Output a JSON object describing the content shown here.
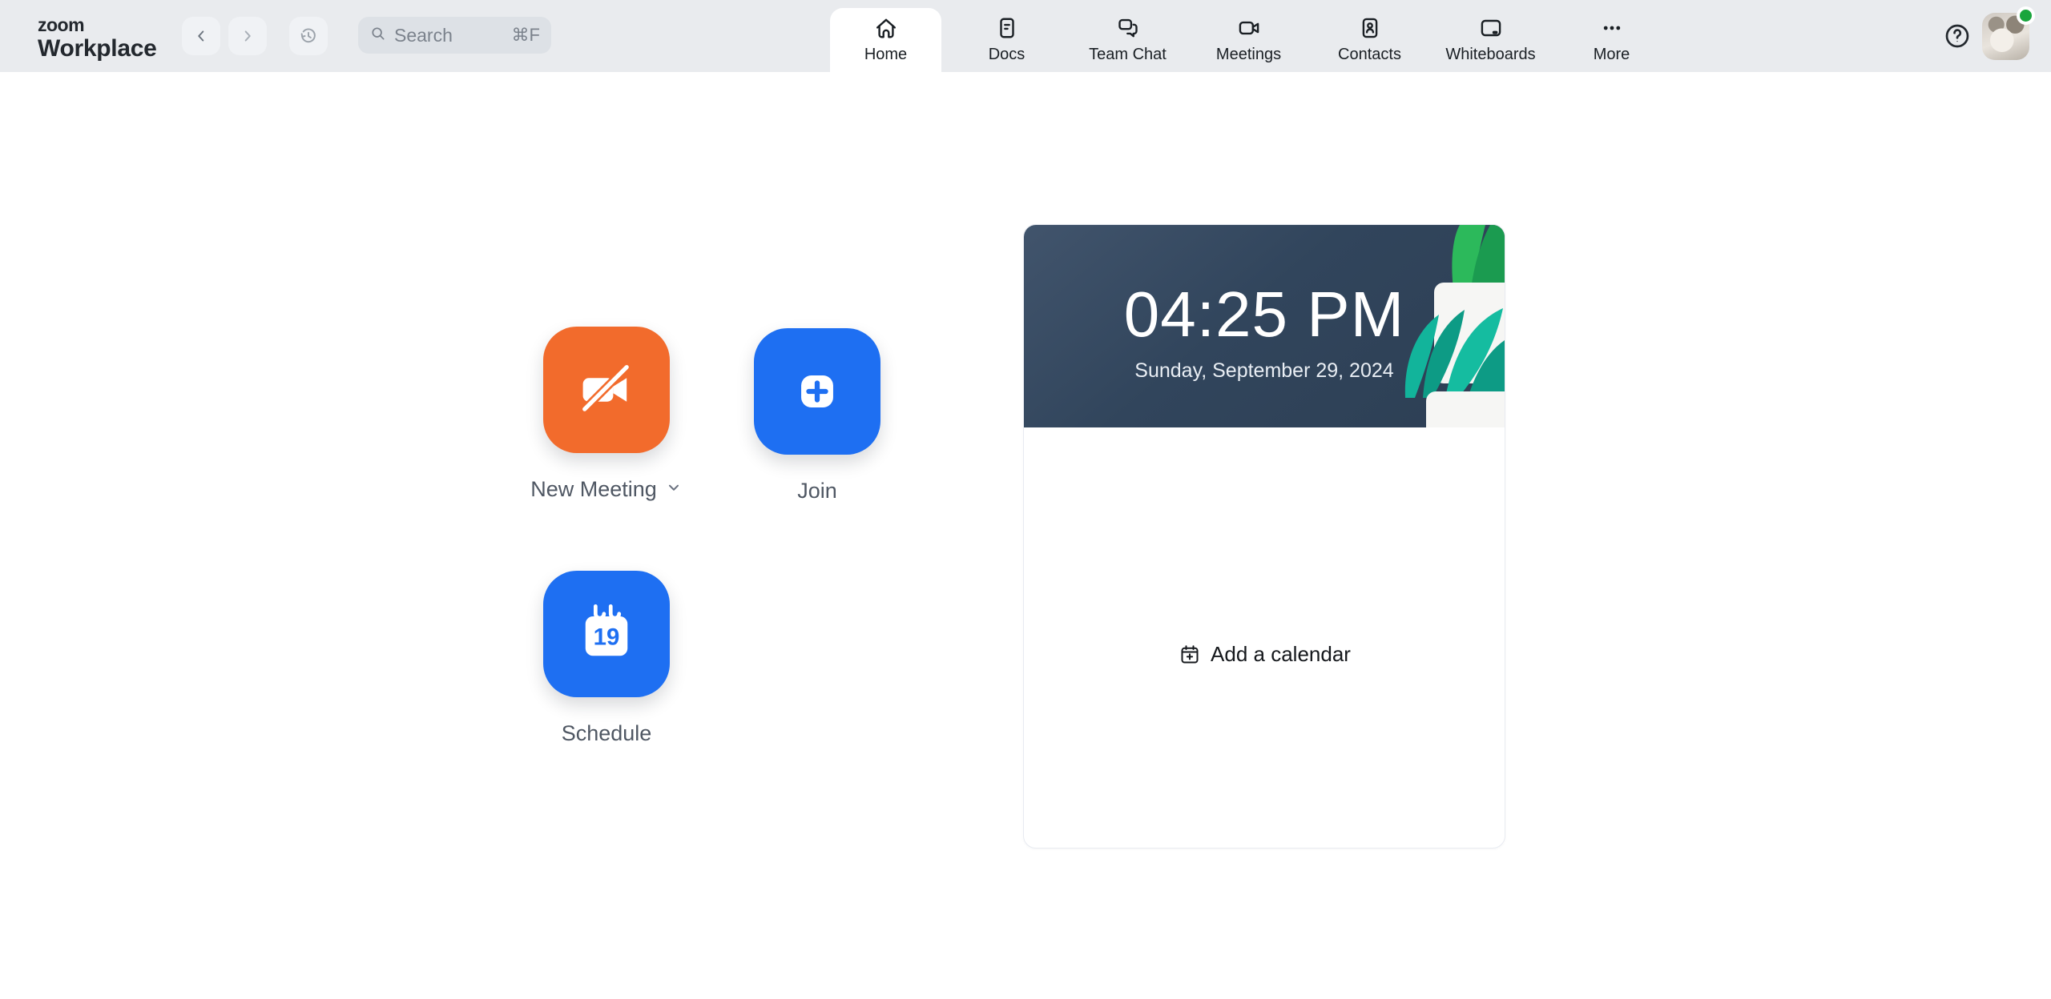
{
  "header": {
    "logo_line1": "zoom",
    "logo_line2": "Workplace",
    "search": {
      "placeholder": "Search",
      "shortcut": "⌘F"
    },
    "tabs": [
      {
        "label": "Home",
        "active": true
      },
      {
        "label": "Docs",
        "active": false
      },
      {
        "label": "Team Chat",
        "active": false
      },
      {
        "label": "Meetings",
        "active": false
      },
      {
        "label": "Contacts",
        "active": false
      },
      {
        "label": "Whiteboards",
        "active": false
      },
      {
        "label": "More",
        "active": false
      }
    ],
    "help_glyph": "?"
  },
  "actions": {
    "new_meeting": {
      "label": "New Meeting"
    },
    "join": {
      "label": "Join"
    },
    "schedule": {
      "label": "Schedule",
      "calendar_day": "19"
    }
  },
  "clock_card": {
    "time": "04:25 PM",
    "date": "Sunday, September 29, 2024",
    "add_calendar": "Add a calendar"
  },
  "colors": {
    "accent_orange": "#F26B2C",
    "accent_blue": "#1E6FF2",
    "banner_navy": "#31455C",
    "presence_green": "#19A53C",
    "header_gray": "#E9EBEE"
  }
}
